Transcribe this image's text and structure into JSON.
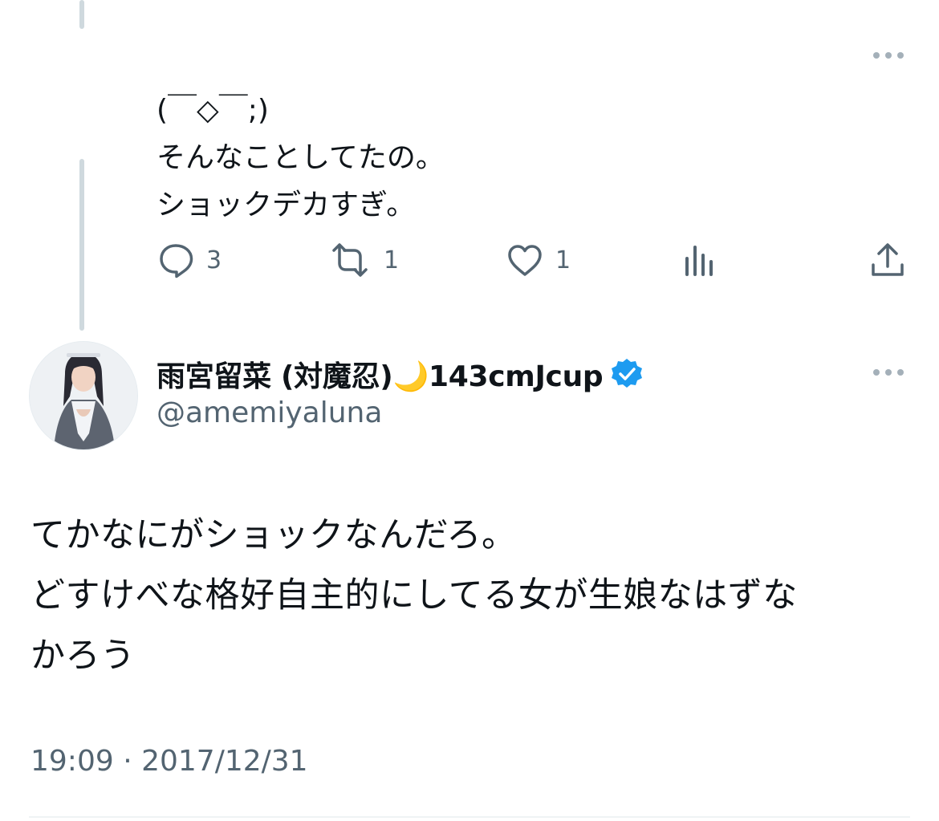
{
  "reply_tweet": {
    "lines": "(￣◇￣;)\nそんなことしてたの。\nショックデカすぎ。",
    "replies": "3",
    "retweets": "1",
    "likes": "1"
  },
  "main_tweet": {
    "display_name": "雨宮留菜 (対魔忍)🌙143cmJcup",
    "handle": "@amemiyaluna",
    "text": "てかなにがショックなんだろ。\nどすけべな格好自主的にしてる女が生娘なはずな\nかろう",
    "timestamp": "19:09 · 2017/12/31"
  },
  "icons": [
    "more-icon",
    "reply-icon",
    "retweet-icon",
    "like-icon",
    "views-icon",
    "share-icon",
    "verified-icon"
  ],
  "colors": {
    "accent": "#1d9bf0",
    "muted": "#536471",
    "line": "#cfd9de"
  }
}
